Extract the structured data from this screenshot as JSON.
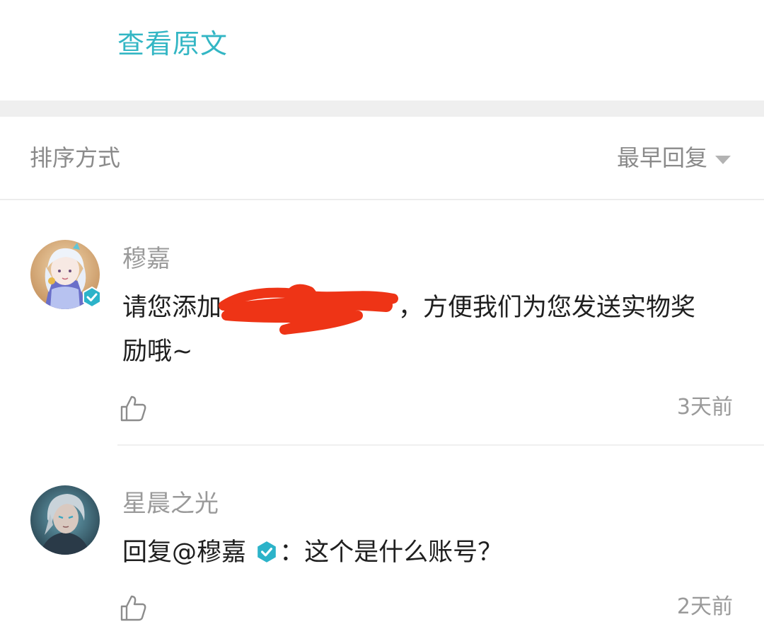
{
  "header": {
    "view_original": "查看原文"
  },
  "sort": {
    "label": "排序方式",
    "value": "最早回复"
  },
  "comments": [
    {
      "author": "穆嘉",
      "verified": true,
      "text_prefix": "请您添加",
      "text_suffix": "，方便我们为您发送实物奖",
      "text_line2": "励哦~",
      "time": "3天前"
    },
    {
      "author": "星晨之光",
      "verified": false,
      "reply_prefix": "回复@穆嘉",
      "reply_suffix": "：这个是什么账号？",
      "time": "2天前"
    }
  ],
  "colors": {
    "accent": "#33b6c4",
    "redaction": "#ee3416",
    "verified": "#2cb3c9"
  }
}
